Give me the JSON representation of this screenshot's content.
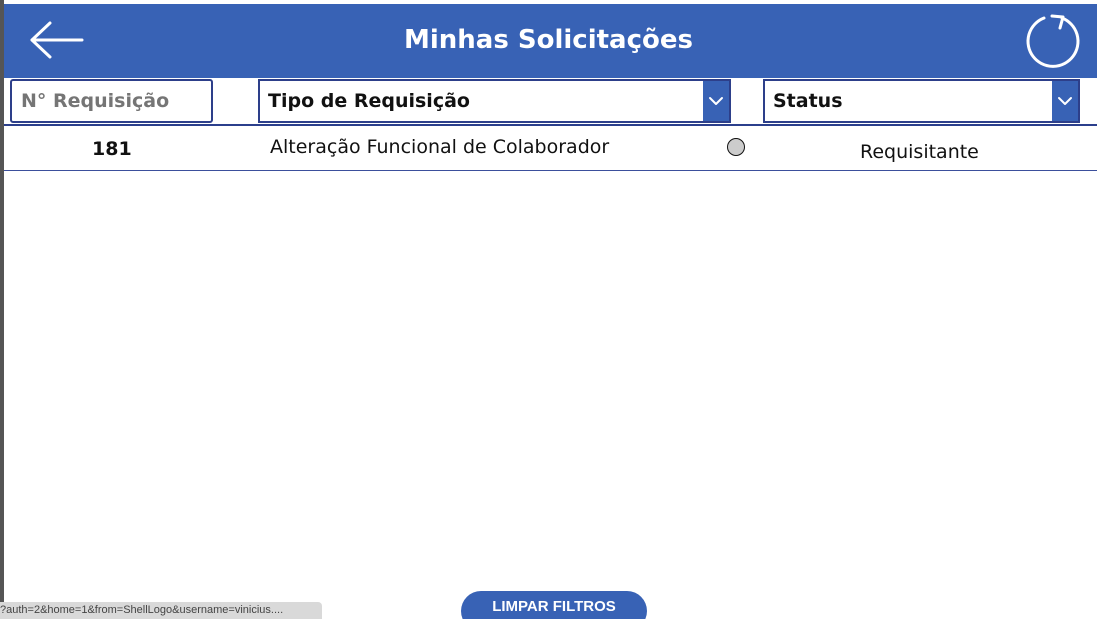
{
  "header": {
    "title": "Minhas Solicitações",
    "back_icon": "arrow-left-icon",
    "refresh_icon": "refresh-icon",
    "background_color": "#3862b5"
  },
  "filters": {
    "requisition_number_placeholder": "N° Requisição",
    "type_dropdown_label": "Tipo de Requisição",
    "status_dropdown_label": "Status"
  },
  "rows": [
    {
      "number": "181",
      "type": "Alteração Funcional de Colaborador",
      "status": "Requisitante"
    }
  ],
  "actions": {
    "clear_filters_label": "LIMPAR FILTROS"
  },
  "status_bar": {
    "url_text": "?auth=2&home=1&from=ShellLogo&username=vinicius...."
  }
}
